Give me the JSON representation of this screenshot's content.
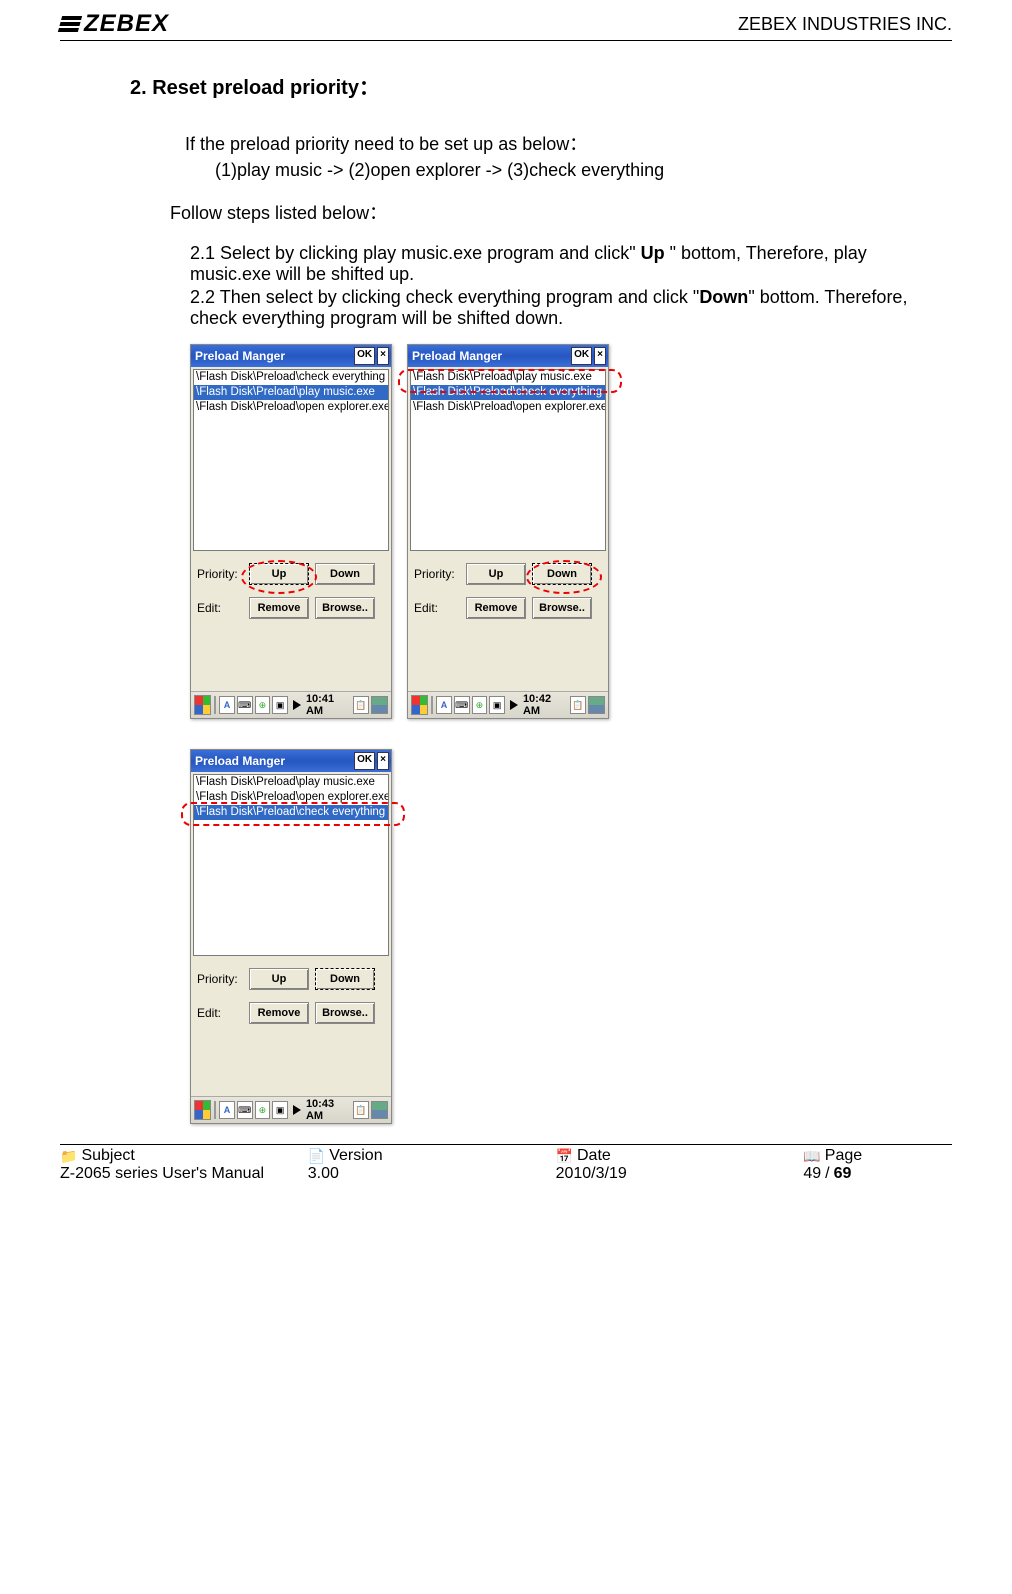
{
  "header": {
    "logo_text": "ZEBEX",
    "company": "ZEBEX INDUSTRIES INC."
  },
  "section": {
    "title": "2. Reset preload priority：",
    "intro_line": "If the preload priority need to be set up as below：",
    "priority_example": "(1)play music -> (2)open explorer -> (3)check everything",
    "follow": "Follow steps listed below：",
    "step1_a": "2.1 Select by clicking play music.exe program and click\" ",
    "step1_bold": "Up",
    "step1_b": " \" bottom, Therefore, play music.exe will be shifted up.",
    "step2_a": "2.2 Then select by clicking check everything program and click \"",
    "step2_bold": "Down",
    "step2_b": "\" bottom. Therefore, check everything program will be shifted down."
  },
  "screenshots": {
    "s1": {
      "title": "Preload Manger",
      "ok": "OK",
      "items": [
        "\\Flash Disk\\Preload\\check everything",
        "\\Flash Disk\\Preload\\play music.exe",
        "\\Flash Disk\\Preload\\open explorer.exe"
      ],
      "selected_index": 1,
      "priority_label": "Priority:",
      "edit_label": "Edit:",
      "up": "Up",
      "down": "Down",
      "remove": "Remove",
      "browse": "Browse..",
      "time": "10:41 AM",
      "highlight": "up"
    },
    "s2": {
      "title": "Preload Manger",
      "ok": "OK",
      "items": [
        "\\Flash Disk\\Preload\\play music.exe",
        "\\Flash Disk\\Preload\\check everything",
        "\\Flash Disk\\Preload\\open explorer.exe"
      ],
      "selected_index": 1,
      "priority_label": "Priority:",
      "edit_label": "Edit:",
      "up": "Up",
      "down": "Down",
      "remove": "Remove",
      "browse": "Browse..",
      "time": "10:42 AM",
      "highlight": "down"
    },
    "s3": {
      "title": "Preload Manger",
      "ok": "OK",
      "items": [
        "\\Flash Disk\\Preload\\play music.exe",
        "\\Flash Disk\\Preload\\open explorer.exe",
        "\\Flash Disk\\Preload\\check everything"
      ],
      "selected_index": 2,
      "priority_label": "Priority:",
      "edit_label": "Edit:",
      "up": "Up",
      "down": "Down",
      "remove": "Remove",
      "browse": "Browse..",
      "time": "10:43 AM",
      "highlight": "row"
    }
  },
  "footer": {
    "subject_label": "Subject",
    "subject_value": "Z-2065 series User's Manual",
    "version_label": "Version",
    "version_value": "3.00",
    "date_label": "Date",
    "date_value": "2010/3/19",
    "page_label": "Page",
    "page_current": "49",
    "page_sep": " / ",
    "page_total": "69"
  }
}
